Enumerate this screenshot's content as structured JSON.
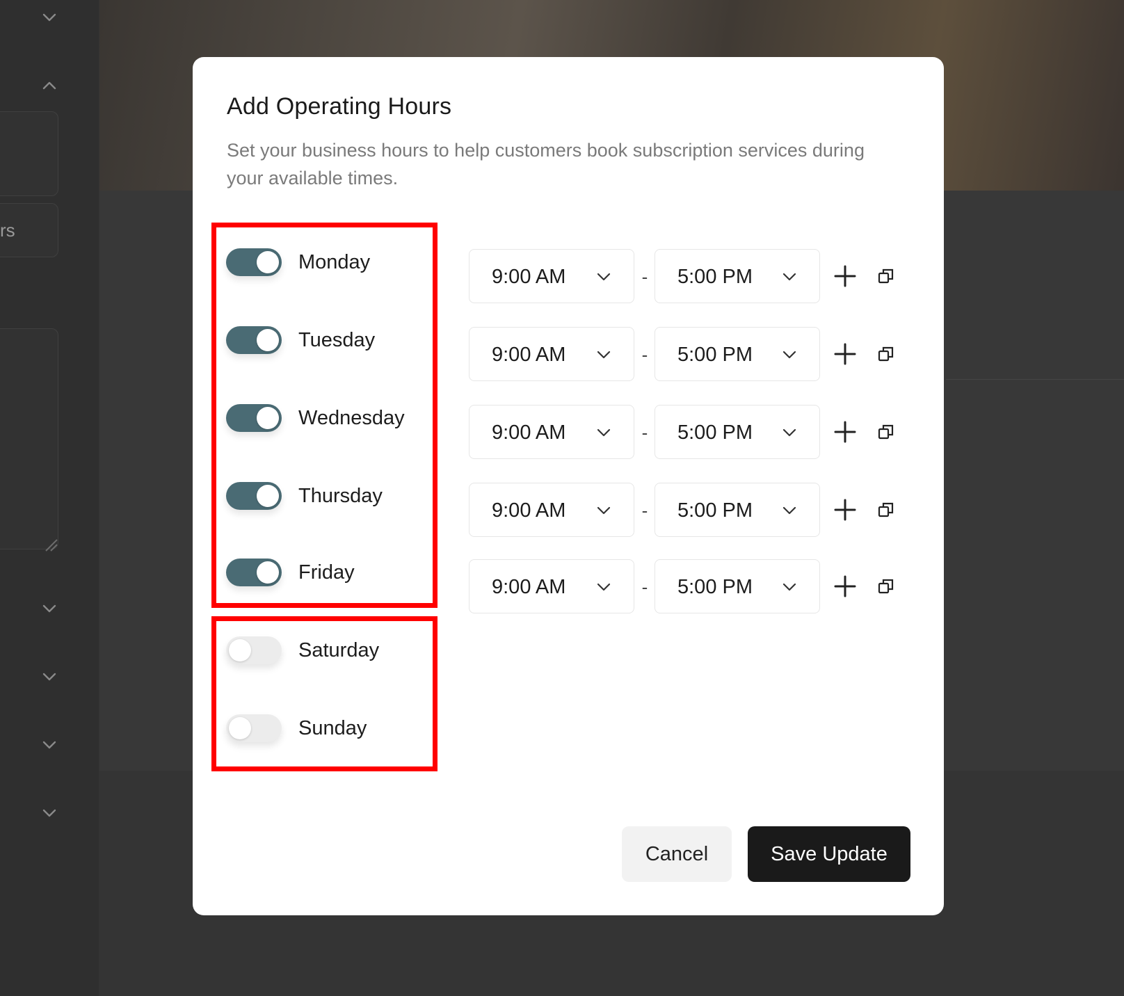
{
  "background": {
    "sidebar_fragment_text": "rs"
  },
  "modal": {
    "title": "Add Operating Hours",
    "description": "Set your business hours to help customers book subscription services during your available times.",
    "separator": "-",
    "days": [
      {
        "label": "Monday",
        "enabled": true,
        "start": "9:00 AM",
        "end": "5:00 PM"
      },
      {
        "label": "Tuesday",
        "enabled": true,
        "start": "9:00 AM",
        "end": "5:00 PM"
      },
      {
        "label": "Wednesday",
        "enabled": true,
        "start": "9:00 AM",
        "end": "5:00 PM"
      },
      {
        "label": "Thursday",
        "enabled": true,
        "start": "9:00 AM",
        "end": "5:00 PM"
      },
      {
        "label": "Friday",
        "enabled": true,
        "start": "9:00 AM",
        "end": "5:00 PM"
      },
      {
        "label": "Saturday",
        "enabled": false
      },
      {
        "label": "Sunday",
        "enabled": false
      }
    ],
    "row_icons": [
      "plus-icon",
      "copy-icon"
    ],
    "cancel_label": "Cancel",
    "save_label": "Save Update"
  },
  "colors": {
    "toggle_on": "#4a6b74",
    "toggle_off": "#ececec",
    "highlight": "#ff0000",
    "primary_button": "#1a1a1a",
    "overlay": "#343434"
  }
}
